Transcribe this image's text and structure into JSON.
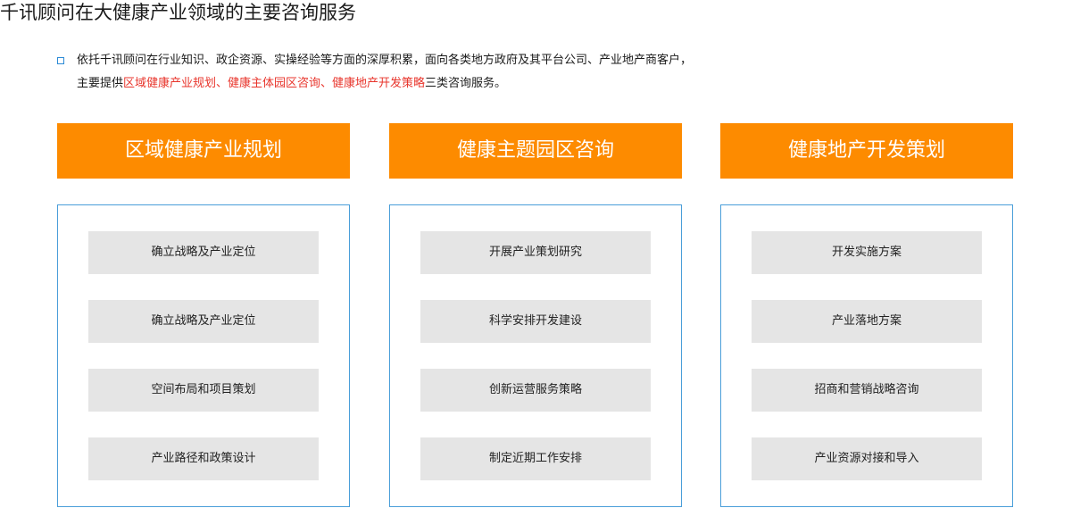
{
  "page": {
    "title": "千讯顾问在大健康产业领域的主要咨询服务"
  },
  "intro": {
    "line1": "依托千讯顾问在行业知识、政企资源、实操经验等方面的深厚积累，面向各类地方政府及其平台公司、产业地产商客户，",
    "line2_prefix": "主要提供",
    "line2_highlight": "区域健康产业规划、健康主体园区咨询、健康地产开发策略",
    "line2_suffix": "三类咨询服务。",
    "highlight_color": "#e8352c",
    "bullet_color": "#2b8ad6"
  },
  "theme": {
    "header_bg": "#fd8b00",
    "box_border": "#4a9ed9",
    "item_bg": "#e5e5e5"
  },
  "columns": [
    {
      "title": "区域健康产业规划",
      "items": [
        "确立战略及产业定位",
        "确立战略及产业定位",
        "空间布局和项目策划",
        "产业路径和政策设计"
      ]
    },
    {
      "title": "健康主题园区咨询",
      "items": [
        "开展产业策划研究",
        "科学安排开发建设",
        "创新运营服务策略",
        "制定近期工作安排"
      ]
    },
    {
      "title": "健康地产开发策划",
      "items": [
        "开发实施方案",
        "产业落地方案",
        "招商和营销战略咨询",
        "产业资源对接和导入"
      ]
    }
  ]
}
